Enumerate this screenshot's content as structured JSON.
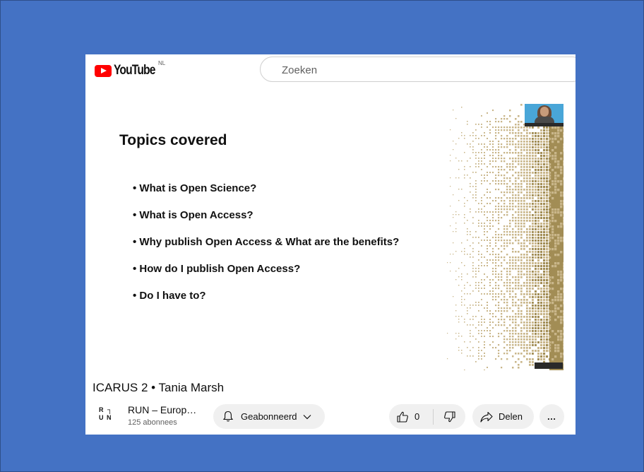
{
  "header": {
    "logo_text": "YouTube",
    "country_code": "NL",
    "search_placeholder": "Zoeken"
  },
  "slide": {
    "title": "Topics covered",
    "bullets": [
      "What is Open Science?",
      "What is Open Access?",
      "Why publish Open Access & What are the benefits?",
      "How do I publish Open Access?",
      "Do I have to?"
    ],
    "pattern_colors": [
      "#c9b68a",
      "#a28d55"
    ]
  },
  "video": {
    "title": "ICARUS 2 • Tania Marsh"
  },
  "channel": {
    "logo_letters": [
      "R",
      "U",
      "N"
    ],
    "name": "RUN – Europ…",
    "subscribers": "125 abonnees"
  },
  "actions": {
    "subscribe_label": "Geabonneerd",
    "like_count": "0",
    "share_label": "Delen",
    "more_label": "…"
  },
  "colors": {
    "background": "#4472c4",
    "youtube_red": "#ff0000",
    "pill_bg": "#f0f0f0"
  }
}
